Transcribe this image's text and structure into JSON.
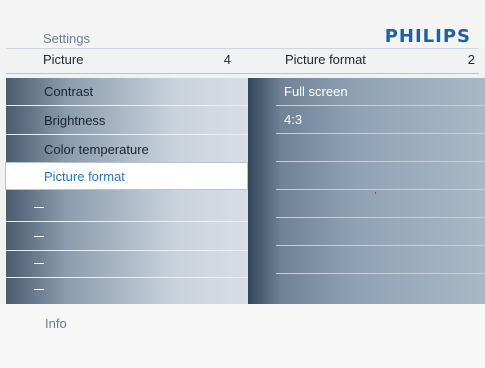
{
  "header": {
    "section_label": "Settings",
    "brand": "PHILIPS"
  },
  "left_column": {
    "title": "Picture",
    "count": "4",
    "items": [
      {
        "label": "Contrast"
      },
      {
        "label": "Brightness"
      },
      {
        "label": "Color temperature"
      },
      {
        "label": "Picture format",
        "selected": true
      }
    ]
  },
  "right_column": {
    "title": "Picture format",
    "count": "2",
    "options": [
      {
        "label": "Full screen"
      },
      {
        "label": "4:3"
      }
    ]
  },
  "footer": {
    "info_label": "Info"
  },
  "colors": {
    "brand": "#1f5fa8",
    "selected_text": "#2a78c8",
    "muted_text": "#6a7f95"
  }
}
